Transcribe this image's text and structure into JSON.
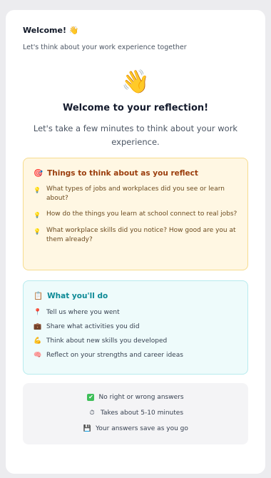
{
  "header": {
    "title": "Welcome! 👋",
    "subtitle": "Let's think about your work experience together"
  },
  "hero": {
    "icon": "👋",
    "title": "Welcome to your reflection!",
    "subtitle": "Let's take a few minutes to think about your work experience."
  },
  "think": {
    "icon": "🎯",
    "title": "Things to think about as you reflect",
    "items": [
      "What types of jobs and workplaces did you see or learn about?",
      "How do the things you learn at school connect to real jobs?",
      "What workplace skills did you notice? How good are you at them already?"
    ]
  },
  "todo": {
    "icon": "📋",
    "title": "What you'll do",
    "items": [
      {
        "icon": "📍",
        "text": "Tell us where you went"
      },
      {
        "icon": "💼",
        "text": "Share what activities you did"
      },
      {
        "icon": "💪",
        "text": "Think about new skills you developed"
      },
      {
        "icon": "🧠",
        "text": "Reflect on your strengths and career ideas"
      }
    ]
  },
  "info": {
    "items": [
      {
        "icon": "✔",
        "text": "No right or wrong answers"
      },
      {
        "icon": "⏱",
        "text": "Takes about 5-10 minutes"
      },
      {
        "icon": "💾",
        "text": "Your answers save as you go"
      }
    ]
  },
  "colors": {
    "think_bg": "#fff7e3",
    "think_title": "#9a3d0c",
    "todo_bg": "#eefbfb",
    "todo_title": "#0d8a96"
  }
}
